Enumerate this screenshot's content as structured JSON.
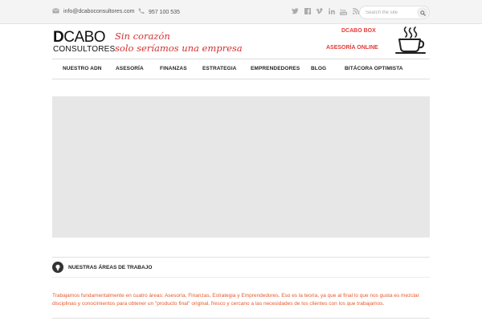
{
  "topbar": {
    "email": "info@dcaboconsultores.com",
    "phone": "957 100 535",
    "social_icons": [
      "twitter-icon",
      "facebook-icon",
      "vimeo-icon",
      "linkedin-icon",
      "youtube-icon",
      "rss-icon"
    ],
    "search_placeholder": "Search the site"
  },
  "logo": {
    "top_bold": "D",
    "top_rest": "CABO",
    "bottom": "CONSULTORES"
  },
  "slogan": {
    "line1": "Sin corazón",
    "line2": "solo seríamos una empresa"
  },
  "header_links": {
    "box": "DCABO BOX",
    "online": "ASESORÍA ONLINE"
  },
  "nav": {
    "items": [
      "NUESTRO ADN",
      "ASESORÍA",
      "FINANZAS",
      "ESTRATEGIA",
      "EMPRENDEDORES",
      "BLOG",
      "BITÁCORA OPTIMISTA"
    ]
  },
  "section": {
    "title": "NUESTRAS ÁREAS DE TRABAJO",
    "text": "Trabajamos fundamentalmente en cuatro áreas: Asesoría, Finanzas, Estrategia y Emprendedores. Eso es la teoría, ya que al final lo que nos gusta es mezclar disciplinas y conocimientos para obtener un \"producto final\" original, fresco y cercano a las necesidades de los clientes con los que trabajamos."
  },
  "colors": {
    "accent": "#e53935",
    "slogan": "#d32f2f",
    "body_text": "#e65a2b",
    "topbar_bg": "#f4f4f4",
    "slider_bg": "#e7e7e7"
  }
}
